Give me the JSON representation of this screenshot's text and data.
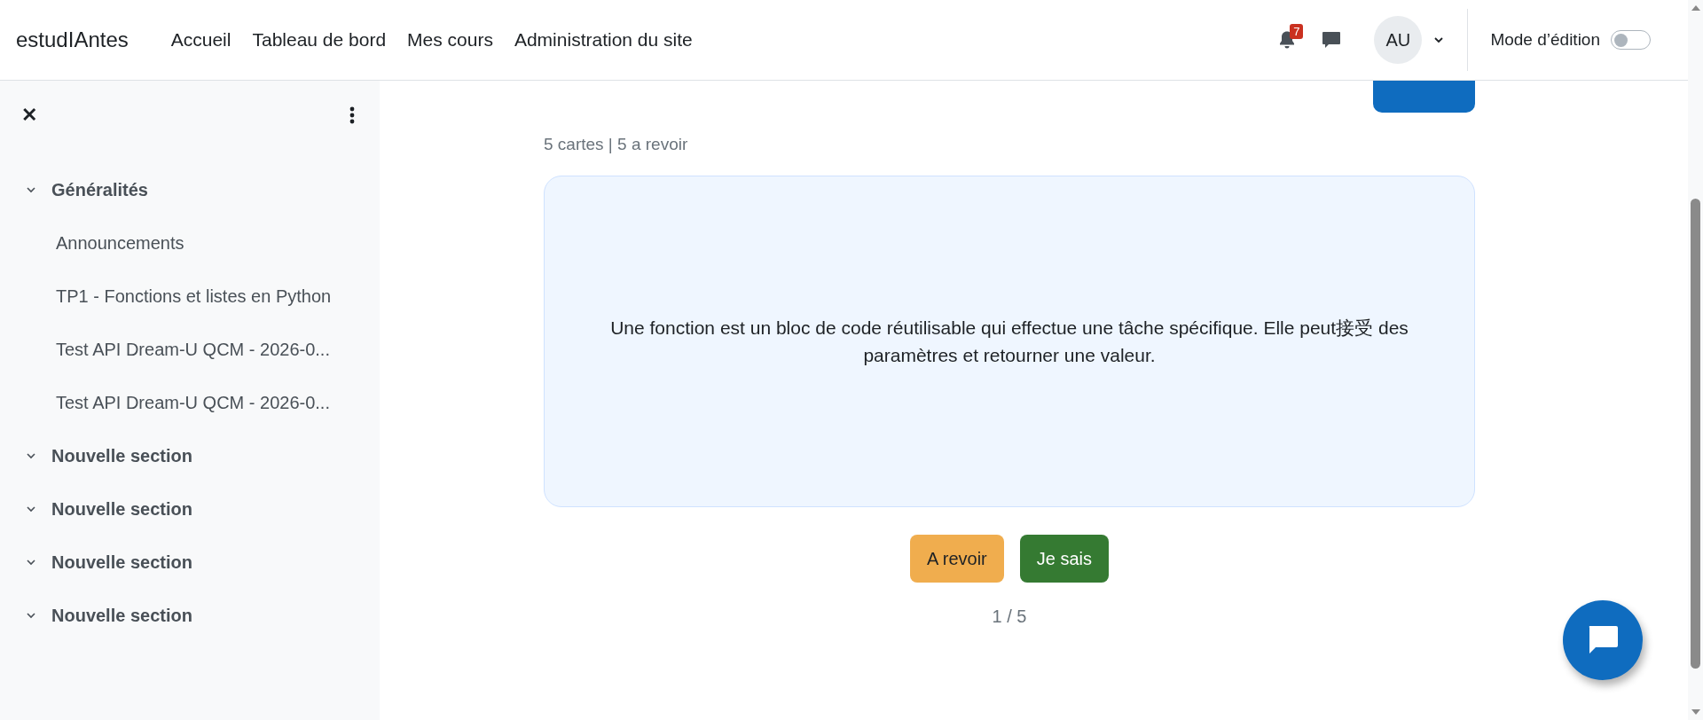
{
  "navbar": {
    "brand": "estudIAntes",
    "links": [
      {
        "label": "Accueil"
      },
      {
        "label": "Tableau de bord"
      },
      {
        "label": "Mes cours"
      },
      {
        "label": "Administration du site"
      }
    ],
    "notifications_count": "7",
    "avatar": "AU",
    "edit_mode": {
      "label": "Mode d’édition",
      "on": false
    }
  },
  "sidebar": {
    "close": "✕",
    "sections": [
      {
        "title": "Généralités",
        "expanded": true,
        "children": [
          {
            "label": "Announcements"
          },
          {
            "label": "TP1 - Fonctions et listes en Python"
          },
          {
            "label": "Test API Dream-U QCM - 2026-0..."
          },
          {
            "label": "Test API Dream-U QCM - 2026-0..."
          }
        ]
      },
      {
        "title": "Nouvelle section",
        "expanded": true
      },
      {
        "title": "Nouvelle section",
        "expanded": true
      },
      {
        "title": "Nouvelle section",
        "expanded": true
      },
      {
        "title": "Nouvelle section",
        "expanded": true
      }
    ]
  },
  "main": {
    "summary": "5 cartes | 5 a revoir",
    "card_text": "Une fonction est un bloc de code réutilisable qui effectue une tâche spécifique. Elle peut接受 des paramètres et retourner une valeur.",
    "buttons": [
      {
        "label": "A revoir",
        "kind": "review"
      },
      {
        "label": "Je sais",
        "kind": "know"
      }
    ],
    "position": "1 / 5"
  }
}
